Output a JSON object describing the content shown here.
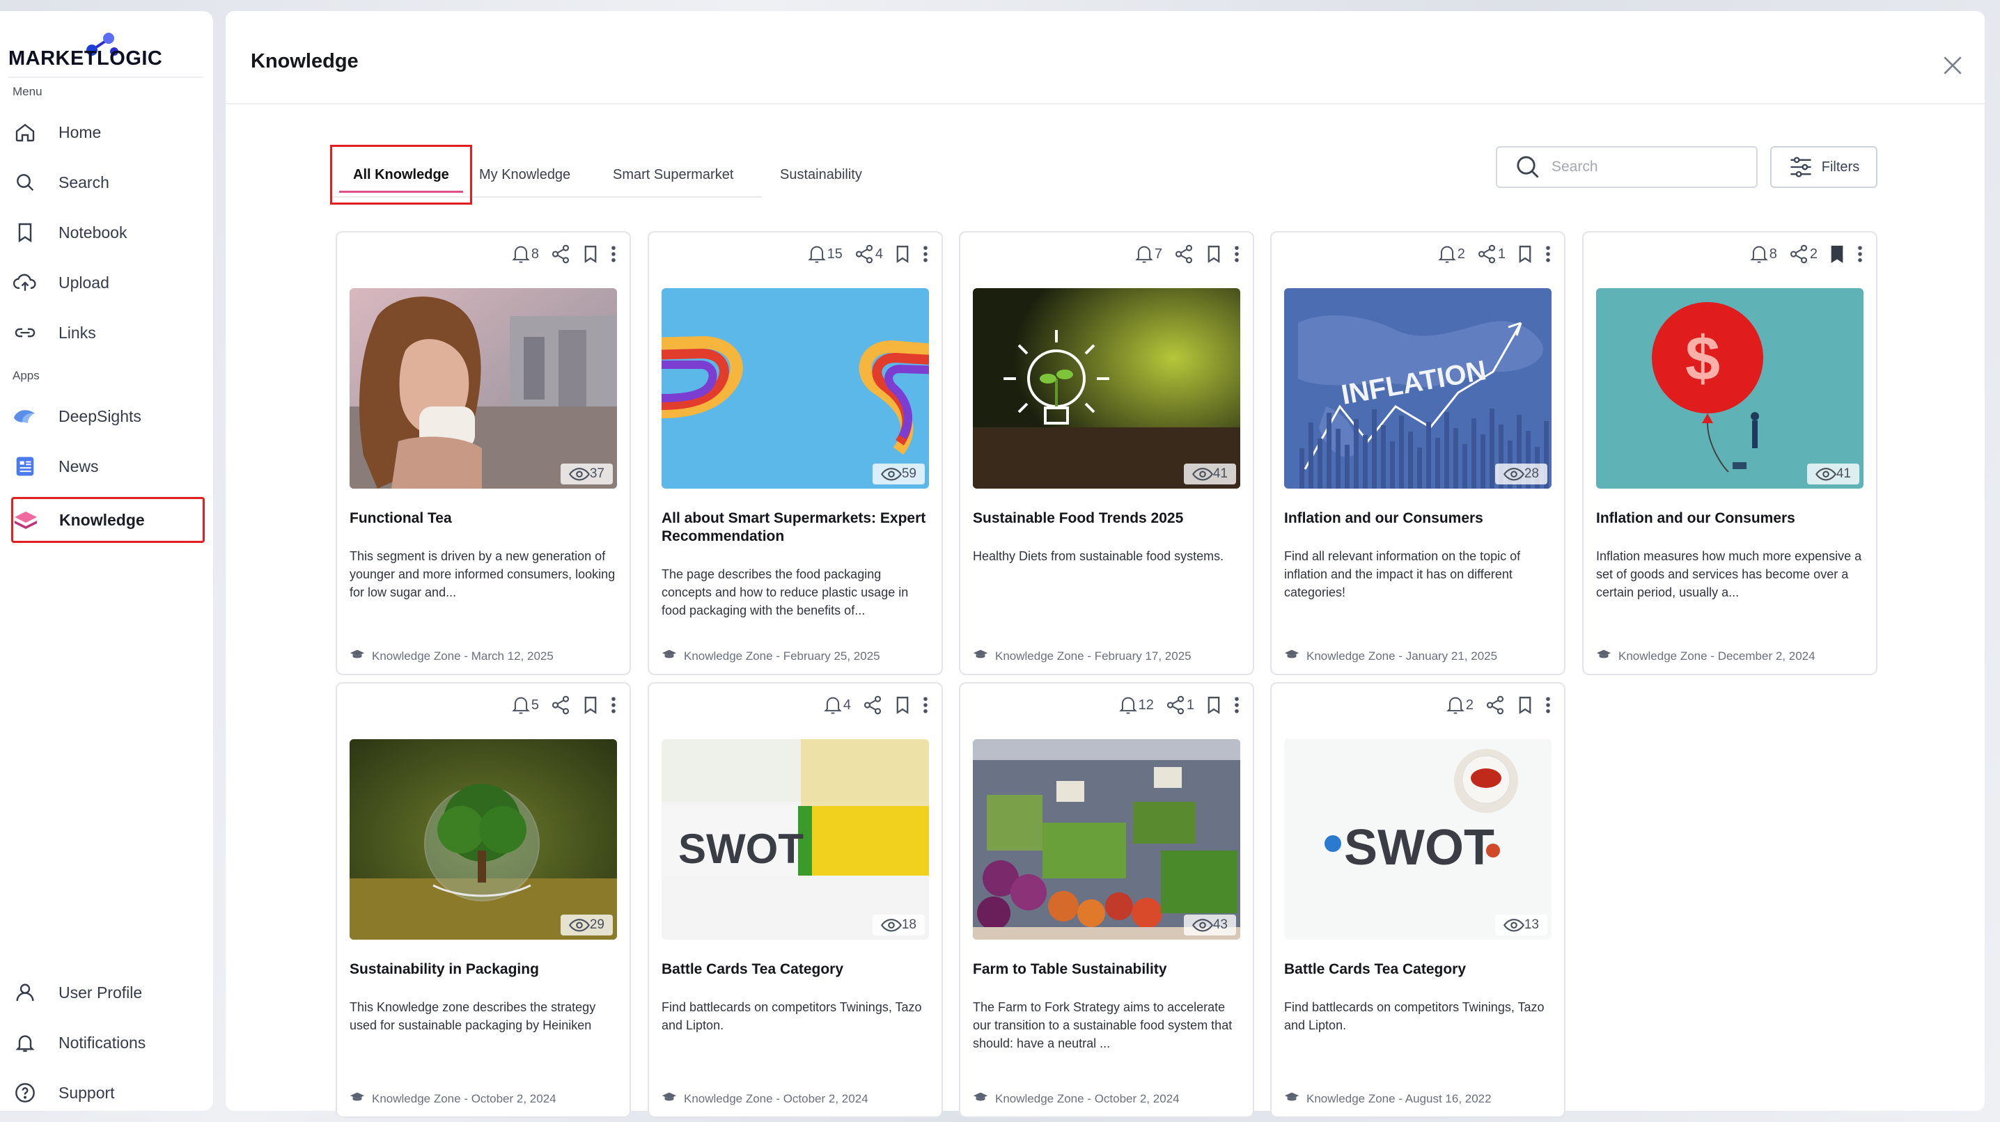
{
  "brand": {
    "logo_text": "MARKETLOGIC",
    "accent": "#e24f86",
    "highlight": "#e02020",
    "logo_dots": [
      "#1c3fd8",
      "#5b6df0",
      "#2b2ec9"
    ]
  },
  "sidebar": {
    "menu_label": "Menu",
    "apps_label": "Apps",
    "menu_items": [
      {
        "label": "Home",
        "icon": "home-icon"
      },
      {
        "label": "Search",
        "icon": "search-icon"
      },
      {
        "label": "Notebook",
        "icon": "bookmark-icon"
      },
      {
        "label": "Upload",
        "icon": "cloud-upload-icon"
      },
      {
        "label": "Links",
        "icon": "link-icon"
      }
    ],
    "app_items": [
      {
        "label": "DeepSights",
        "icon": "deepsights-icon"
      },
      {
        "label": "News",
        "icon": "news-icon"
      },
      {
        "label": "Knowledge",
        "icon": "knowledge-icon",
        "active": true
      }
    ],
    "bottom_items": [
      {
        "label": "User Profile",
        "icon": "user-icon"
      },
      {
        "label": "Notifications",
        "icon": "bell-icon"
      },
      {
        "label": "Support",
        "icon": "help-icon"
      }
    ]
  },
  "main": {
    "title": "Knowledge",
    "tabs": [
      {
        "label": "All Knowledge",
        "active": true
      },
      {
        "label": "My Knowledge"
      },
      {
        "label": "Smart Supermarket"
      },
      {
        "label": "Sustainability"
      }
    ],
    "search_placeholder": "Search",
    "filters_label": "Filters"
  },
  "cards": [
    {
      "title": "Functional Tea",
      "description": "This segment is driven by a new generation of younger and more informed consumers, looking for low sugar and...",
      "meta": "Knowledge Zone - March 12, 2025",
      "bell": "8",
      "share": "",
      "bookmarked": false,
      "views": "37",
      "image": "woman-drinking-tea"
    },
    {
      "title": "All about Smart Supermarkets: Expert Recommendation",
      "description": "The page describes the food packaging concepts and how to reduce plastic usage in food packaging with the benefits of...",
      "meta": "Knowledge Zone - February 25, 2025",
      "bell": "15",
      "share": "4",
      "bookmarked": false,
      "views": "59",
      "image": "colorful-waves"
    },
    {
      "title": "Sustainable Food Trends 2025",
      "description": "Healthy Diets from sustainable food systems.",
      "meta": "Knowledge Zone - February 17, 2025",
      "bell": "7",
      "share": "",
      "bookmarked": false,
      "views": "41",
      "image": "lightbulb-sprout"
    },
    {
      "title": "Inflation and our Consumers",
      "description": "Find all relevant information on the topic of inflation and the impact it has on different categories!",
      "meta": "Knowledge Zone - January 21, 2025",
      "bell": "2",
      "share": "1",
      "bookmarked": false,
      "views": "28",
      "image": "inflation-map",
      "image_text": "INFLATION"
    },
    {
      "title": "Inflation and our Consumers",
      "description": "Inflation measures how much more expensive a set of goods and services has become over a certain period, usually a...",
      "meta": "Knowledge Zone - December 2, 2024",
      "bell": "8",
      "share": "2",
      "bookmarked": true,
      "views": "41",
      "image": "dollar-balloon"
    },
    {
      "title": "Sustainability in Packaging",
      "description": "This Knowledge zone describes the strategy used for sustainable packaging by Heiniken",
      "meta": "Knowledge Zone - October 2, 2024",
      "bell": "5",
      "share": "",
      "bookmarked": false,
      "views": "29",
      "image": "tree-in-glass"
    },
    {
      "title": "Battle Cards Tea Category",
      "description": "Find battlecards on competitors Twinings, Tazo and Lipton.",
      "meta": "Knowledge Zone - October 2, 2024",
      "bell": "4",
      "share": "",
      "bookmarked": false,
      "views": "18",
      "image": "swot-yellow",
      "image_text": "SWOT"
    },
    {
      "title": "Farm to Table Sustainability",
      "description": "The Farm to Fork Strategy aims to accelerate our transition to a sustainable food system that should: have a neutral ...",
      "meta": "Knowledge Zone - October 2, 2024",
      "bell": "12",
      "share": "1",
      "bookmarked": false,
      "views": "43",
      "image": "vegetable-market"
    },
    {
      "title": "Battle Cards Tea Category",
      "description": "Find battlecards on competitors Twinings, Tazo and Lipton.",
      "meta": "Knowledge Zone - August 16, 2022",
      "bell": "2",
      "share": "",
      "bookmarked": false,
      "views": "13",
      "image": "swot-teacup",
      "image_text": "SWOT"
    }
  ]
}
